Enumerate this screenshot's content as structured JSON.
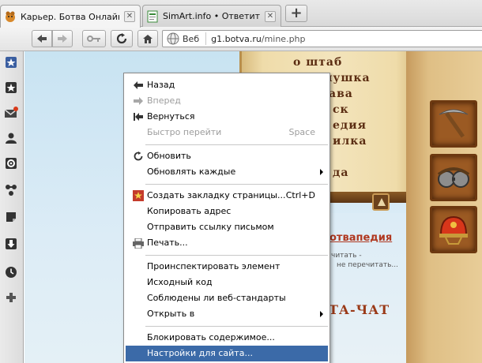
{
  "tabs": [
    {
      "title": "Карьер. Ботва Онлайн ...",
      "active": true,
      "favicon": "botva-favicon-icon"
    },
    {
      "title": "SimArt.info • Ответить",
      "active": false,
      "favicon": "document-favicon-icon"
    }
  ],
  "toolbar": {
    "badge": "Веб",
    "url_host": "g1.botva.ru",
    "url_path": "/mine.php"
  },
  "page": {
    "menu_words": [
      "о штаб",
      "кормушка",
      "ава",
      "ск",
      "едия",
      "илка",
      "да"
    ],
    "link": "отвапедия",
    "small_text_1": "читать -",
    "small_text_2": "не перечитать...",
    "chat": "ТА-ЧАТ"
  },
  "context_menu": {
    "items": [
      {
        "label": "Назад",
        "icon": "back-arrow-icon",
        "disabled": false
      },
      {
        "label": "Вперед",
        "icon": "forward-arrow-icon",
        "disabled": true
      },
      {
        "label": "Вернуться",
        "icon": "rewind-icon",
        "disabled": false
      },
      {
        "label": "Быстро перейти",
        "shortcut": "Space",
        "disabled": true
      },
      {
        "label": "Обновить",
        "icon": "reload-icon",
        "disabled": false
      },
      {
        "label": "Обновлять каждые",
        "submenu": true,
        "disabled": false
      },
      {
        "label": "Создать закладку страницы...",
        "shortcut": "Ctrl+D",
        "icon": "bookmark-star-icon",
        "disabled": false
      },
      {
        "label": "Копировать адрес",
        "disabled": false
      },
      {
        "label": "Отправить ссылку письмом",
        "disabled": false
      },
      {
        "label": "Печать...",
        "icon": "printer-icon",
        "disabled": false
      },
      {
        "label": "Проинспектировать элемент",
        "disabled": false
      },
      {
        "label": "Исходный код",
        "disabled": false
      },
      {
        "label": "Соблюдены ли веб-стандарты",
        "disabled": false
      },
      {
        "label": "Открыть в",
        "submenu": true,
        "disabled": false
      },
      {
        "label": "Блокировать содержимое...",
        "disabled": false
      },
      {
        "label": "Настройки для сайта...",
        "highlighted": true,
        "disabled": false
      }
    ]
  },
  "colors": {
    "menu_highlight": "#3b6aa8",
    "page_sky": "#c8e3f2",
    "parchment": "#f0dfb4",
    "link_red": "#b03820"
  }
}
